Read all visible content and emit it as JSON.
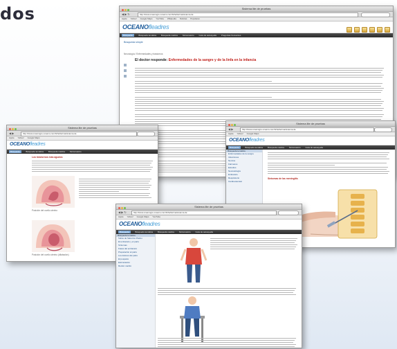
{
  "headline": "dos",
  "browser": {
    "window_title": "Sistema lite de pruebas",
    "url": "http://www.oceanogre.oceano.com/ficheflerima/sistema.de",
    "bookmarks": [
      "Apple",
      "Yahoo!",
      "Google Maps",
      "YouTube",
      "Wikipedia",
      "Noticias",
      "Populares"
    ]
  },
  "site": {
    "logo_main": "OCEANO",
    "logo_sub": "fleadres",
    "menu": [
      "Búsqueda",
      "Búsqueda temática",
      "Búsqueda médica",
      "Sintomatorio",
      "Guía de autoayuda",
      "Preguntas frecuentes"
    ]
  },
  "shot_main": {
    "page_label": "Búsqueda simple",
    "breadcrumb": "Neurología / Enfermedades y trastornos",
    "title_plain": "El doctor responde:",
    "title_red": "Enfermedades de la sangre y de la linfa en la infancia"
  },
  "shot_left": {
    "section_title": "Los trastornos más agudos",
    "caption_1": "Posición del cuello uterino",
    "caption_2": "Posición del cuello uterino (dilatación)"
  },
  "shot_right": {
    "sidebar_title": "Búsqueda temática",
    "sidebar_items": [
      "Enfermedades de la sangre",
      "Infecciones",
      "Nervios",
      "Fármacos",
      "Estudios",
      "Neonatología",
      "Embarazo",
      "Respiratorio",
      "Cardiovascular"
    ],
    "section_title": "Síntomas de las meningitis"
  },
  "shot_bottom": {
    "sidebar_title": "Búsqueda temática",
    "sidebar_items": [
      "Índice de Salud de Platino",
      "El embarazo y el parto",
      "Síntomas",
      "Fases del embarazo",
      "Preparación al parto",
      "Los dolores del parto",
      "El posparto",
      "Estimulación",
      "Recién nacido"
    ]
  },
  "colors": {
    "accent_blue": "#1d5b9a",
    "title_red": "#c2231d",
    "menu_bg": "#2b2b2b"
  }
}
